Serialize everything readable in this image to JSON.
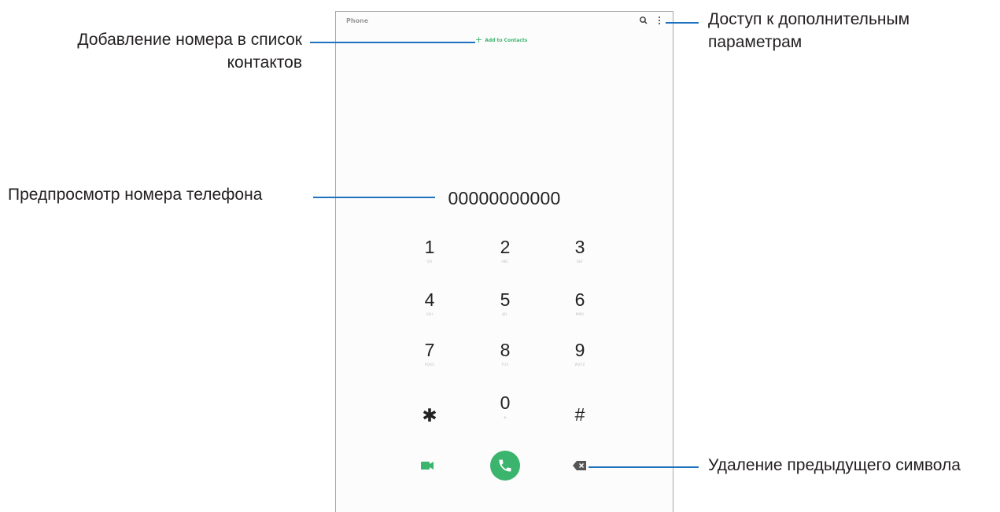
{
  "app": {
    "title": "Phone",
    "search_icon": "search-icon",
    "more_icon": "more-options-icon"
  },
  "add_contacts": {
    "icon": "plus-icon",
    "label": "Add to Contacts"
  },
  "dial": {
    "number": "00000000000"
  },
  "keypad": [
    {
      "digit": "1",
      "letters": "QO"
    },
    {
      "digit": "2",
      "letters": "ABC"
    },
    {
      "digit": "3",
      "letters": "DEF"
    },
    {
      "digit": "4",
      "letters": "GHI"
    },
    {
      "digit": "5",
      "letters": "JKL"
    },
    {
      "digit": "6",
      "letters": "MNO"
    },
    {
      "digit": "7",
      "letters": "PQRS"
    },
    {
      "digit": "8",
      "letters": "TUV"
    },
    {
      "digit": "9",
      "letters": "WXYZ"
    },
    {
      "digit": "✱",
      "letters": ""
    },
    {
      "digit": "0",
      "letters": "+"
    },
    {
      "digit": "#",
      "letters": ""
    }
  ],
  "actions": {
    "video_icon": "video-call-icon",
    "call_icon": "phone-call-icon",
    "backspace_icon": "backspace-icon"
  },
  "callouts": {
    "add_contact": "Добавление номера в список контактов",
    "more_options": "Доступ к дополнительным параметрам",
    "preview": "Предпросмотр номера телефона",
    "delete": "Удаление предыдущего символа"
  },
  "colors": {
    "accent": "#3bb46e",
    "callout_line": "#1e73be"
  }
}
